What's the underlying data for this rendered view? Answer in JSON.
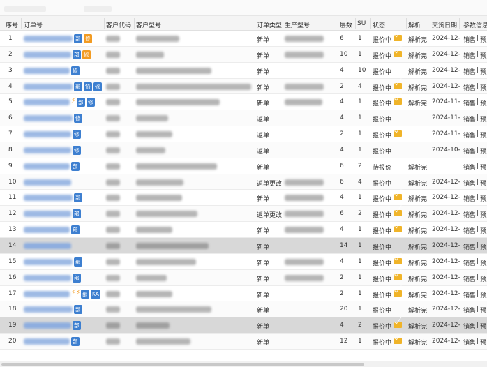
{
  "columns": {
    "seq": "序号",
    "order_no": "订单号",
    "customer_code": "客户代码",
    "customer_model": "客户型号",
    "order_type": "订单类型",
    "production_model": "生产型号",
    "layers": "层数",
    "su": "SU",
    "status": "状态",
    "parse": "解析",
    "delivery_date": "交货日期",
    "params": "参数信息"
  },
  "action_links": {
    "sales": "销售",
    "sep": "|",
    "preview": "预览"
  },
  "colors": {
    "accent": "#3d7fd0",
    "badge_orange": "#f29b22",
    "mail_icon": "#f0b429",
    "selected_row": "#d8d8d8"
  },
  "rows": [
    {
      "seq": "1",
      "badges": [
        "部",
        "修"
      ],
      "order_type": "新单",
      "layers": "6",
      "su": "1",
      "status": "报价中",
      "mail": true,
      "parse": "解析完",
      "date": "2024-12-"
    },
    {
      "seq": "2",
      "badges": [
        "部",
        "修"
      ],
      "order_type": "新单",
      "layers": "10",
      "su": "1",
      "status": "报价中",
      "mail": true,
      "parse": "解析完",
      "date": "2024-12-"
    },
    {
      "seq": "3",
      "badges": [
        "修"
      ],
      "order_type": "新单",
      "layers": "4",
      "su": "10",
      "status": "报价中",
      "mail": false,
      "parse": "解析完",
      "date": "2024-12-"
    },
    {
      "seq": "4",
      "badges": [
        "部",
        "铅",
        "修"
      ],
      "order_type": "新单",
      "layers": "2",
      "su": "4",
      "status": "报价中",
      "mail": true,
      "parse": "解析完",
      "date": "2024-12-"
    },
    {
      "seq": "5",
      "badges": [
        "⚡",
        "部",
        "修"
      ],
      "order_type": "新单",
      "layers": "4",
      "su": "1",
      "status": "报价中",
      "mail": true,
      "parse": "解析完",
      "date": "2024-11-"
    },
    {
      "seq": "6",
      "badges": [
        "修"
      ],
      "order_type": "返单",
      "layers": "4",
      "su": "1",
      "status": "报价中",
      "mail": false,
      "parse": "",
      "date": "2024-11-"
    },
    {
      "seq": "7",
      "badges": [
        "修"
      ],
      "order_type": "返单",
      "layers": "2",
      "su": "1",
      "status": "报价中",
      "mail": true,
      "parse": "",
      "date": "2024-11-"
    },
    {
      "seq": "8",
      "badges": [
        "修"
      ],
      "order_type": "返单",
      "layers": "4",
      "su": "1",
      "status": "报价中",
      "mail": false,
      "parse": "",
      "date": "2024-10-"
    },
    {
      "seq": "9",
      "badges": [
        "部"
      ],
      "order_type": "新单",
      "layers": "6",
      "su": "2",
      "status": "待报价",
      "mail": false,
      "parse": "解析完",
      "date": ""
    },
    {
      "seq": "10",
      "badges": [],
      "order_type": "返单更改",
      "layers": "6",
      "su": "4",
      "status": "报价中",
      "mail": false,
      "parse": "解析完",
      "date": "2024-12-"
    },
    {
      "seq": "11",
      "badges": [
        "部"
      ],
      "order_type": "新单",
      "layers": "4",
      "su": "1",
      "status": "报价中",
      "mail": true,
      "parse": "解析完",
      "date": "2024-12-"
    },
    {
      "seq": "12",
      "badges": [
        "部"
      ],
      "order_type": "返单更改",
      "layers": "6",
      "su": "2",
      "status": "报价中",
      "mail": true,
      "parse": "解析完",
      "date": "2024-12-"
    },
    {
      "seq": "13",
      "badges": [
        "部"
      ],
      "order_type": "新单",
      "layers": "4",
      "su": "1",
      "status": "报价中",
      "mail": true,
      "parse": "解析完",
      "date": "2024-12-"
    },
    {
      "seq": "14",
      "badges": [],
      "order_type": "新单",
      "layers": "14",
      "su": "1",
      "status": "报价中",
      "mail": false,
      "parse": "解析完",
      "date": "2024-12-",
      "selected": true
    },
    {
      "seq": "15",
      "badges": [
        "部"
      ],
      "order_type": "新单",
      "layers": "4",
      "su": "1",
      "status": "报价中",
      "mail": true,
      "parse": "解析完",
      "date": "2024-12-"
    },
    {
      "seq": "16",
      "badges": [
        "部"
      ],
      "order_type": "新单",
      "layers": "2",
      "su": "1",
      "status": "报价中",
      "mail": true,
      "parse": "解析完",
      "date": "2024-12-"
    },
    {
      "seq": "17",
      "badges": [
        "⚡⚡",
        "部",
        "KA"
      ],
      "order_type": "新单",
      "layers": "2",
      "su": "1",
      "status": "报价中",
      "mail": true,
      "parse": "解析完",
      "date": "2024-12-"
    },
    {
      "seq": "18",
      "badges": [
        "部"
      ],
      "order_type": "新单",
      "layers": "20",
      "su": "1",
      "status": "报价中",
      "mail": false,
      "parse": "解析完",
      "date": "2024-12-"
    },
    {
      "seq": "19",
      "badges": [
        "部"
      ],
      "order_type": "新单",
      "layers": "4",
      "su": "2",
      "status": "报价中",
      "mail": true,
      "parse": "解析完",
      "date": "2024-12-",
      "selected": true
    },
    {
      "seq": "20",
      "badges": [
        "部"
      ],
      "order_type": "新单",
      "layers": "12",
      "su": "1",
      "status": "报价中",
      "mail": true,
      "parse": "解析完",
      "date": "2024-12-"
    }
  ]
}
